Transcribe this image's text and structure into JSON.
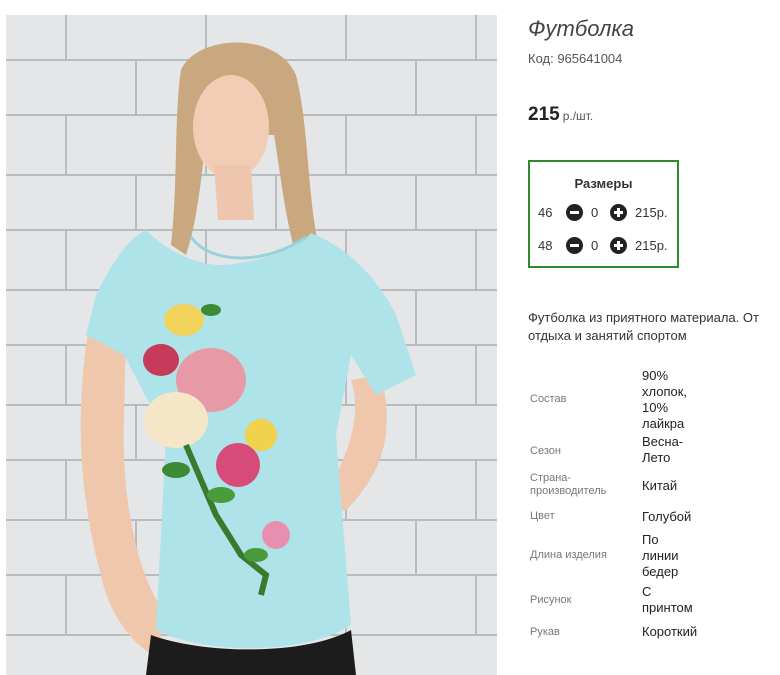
{
  "product": {
    "title": "Футболка",
    "sku": "Код: 965641004",
    "price": "215",
    "price_unit": "р./шт."
  },
  "sizes": {
    "title": "Размеры",
    "rows": [
      {
        "size": "46",
        "qty": "0",
        "price": "215р."
      },
      {
        "size": "48",
        "qty": "0",
        "price": "215р."
      }
    ],
    "icons": {
      "decrease": "minus-circle-icon",
      "increase": "plus-circle-icon"
    },
    "accent_color": "#2c8b2c"
  },
  "description": {
    "line1": "Футболка из приятного материала. От",
    "line2": "отдыха и занятий спортом"
  },
  "attributes": [
    {
      "key": "Состав",
      "value_lines": [
        "90%",
        "хлопок,",
        "10%",
        "лайкра"
      ]
    },
    {
      "key": "Сезон",
      "value_lines": [
        "Весна-",
        "Лето"
      ]
    },
    {
      "key": "Страна-производитель",
      "key_lines": [
        "Страна-",
        "производитель"
      ],
      "value_lines": [
        "Китай"
      ]
    },
    {
      "key": "Цвет",
      "value_lines": [
        "Голубой"
      ]
    },
    {
      "key": "Длина изделия",
      "value_lines": [
        "По",
        "линии",
        "бедер"
      ]
    },
    {
      "key": "Рисунок",
      "value_lines": [
        "С",
        "принтом"
      ]
    },
    {
      "key": "Рукав",
      "value_lines": [
        "Короткий"
      ]
    }
  ]
}
